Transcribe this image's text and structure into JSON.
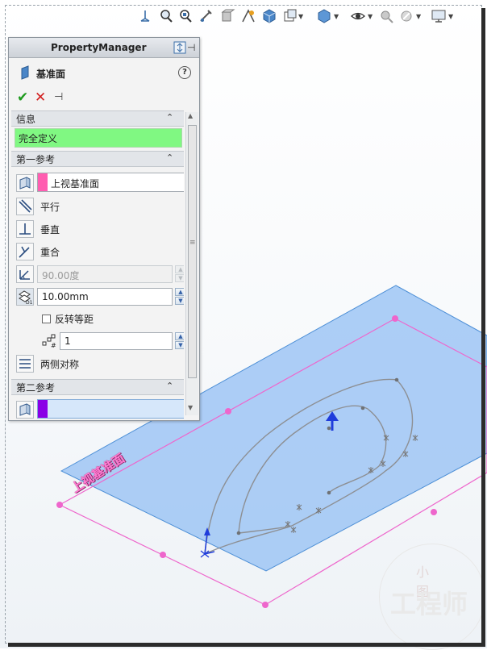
{
  "colors": {
    "plane_fill": "#9fc6f4",
    "plane_edge": "#4d8fd6",
    "sketch_plane": "#ee66cc",
    "sketch_curve": "#8d8f93",
    "info_green": "#80f882",
    "ref1_swatch": "#ff5db0",
    "ref2_swatch": "#8a00e6"
  },
  "toolbar": {
    "icons": [
      "view-orientation-icon",
      "zoom-to-fit-icon",
      "zoom-area-icon",
      "previous-view-icon",
      "section-view-icon",
      "dynamic-annotation-icon",
      "view-orientation-cube-icon",
      "display-style-icon",
      "hide-show-items-icon",
      "edit-appearance-icon",
      "apply-scene-icon",
      "view-settings-icon"
    ]
  },
  "pm": {
    "title": "PropertyManager",
    "feature_name": "基准面",
    "feature_icon": "reference-plane-icon",
    "help_label": "?",
    "ok_label": "✔",
    "cancel_label": "✕",
    "pin_label": "⊣",
    "info": {
      "title": "信息",
      "status": "完全定义"
    },
    "first_ref": {
      "title": "第一参考",
      "selection": "上视基准面",
      "options": {
        "parallel": "平行",
        "perpendicular": "垂直",
        "coincident": "重合"
      },
      "angle": "90.00度",
      "distance": "10.00mm",
      "flip_label": "反转等距",
      "count": "1",
      "mid_plane": "两侧对称"
    },
    "second_ref": {
      "title": "第二参考",
      "selection": ""
    }
  },
  "viewport": {
    "plane_label": "上视基准面",
    "watermark_small": "小 图",
    "watermark_main": "工程师"
  }
}
